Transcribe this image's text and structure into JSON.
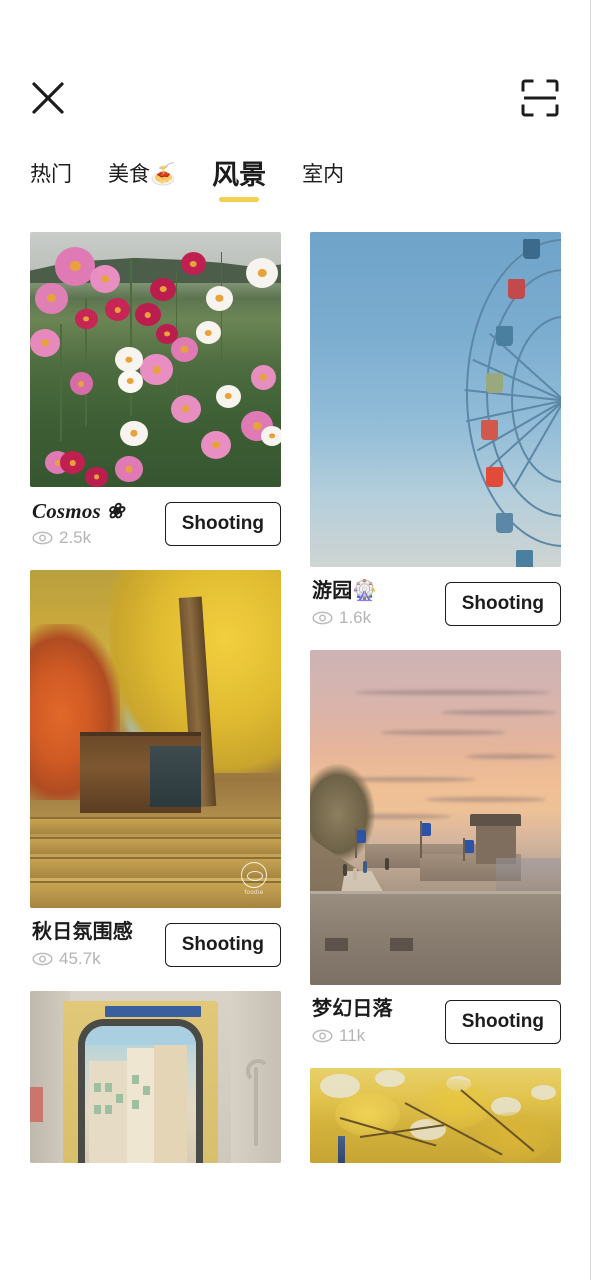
{
  "header": {
    "close_icon": "close-icon",
    "scan_icon": "scan-frame-icon"
  },
  "tabs": [
    {
      "label": "热门",
      "active": false
    },
    {
      "label": "美食🍝",
      "active": false
    },
    {
      "label": "风景",
      "active": true
    },
    {
      "label": "室内",
      "active": false
    }
  ],
  "accent_color": "#f5cf52",
  "shoot_label": "Shooting",
  "cards": {
    "left": [
      {
        "title": "Cosmos ❀",
        "title_style": "serif-italic",
        "views": "2.5k",
        "action": "Shooting",
        "photo": "cosmos-flower-field"
      },
      {
        "title": "秋日氛围感",
        "title_style": "sans",
        "views": "45.7k",
        "action": "Shooting",
        "photo": "autumn-cafe-ginkgo",
        "watermark": "foodie"
      },
      {
        "title": "",
        "title_style": "sans",
        "views": "",
        "action": "",
        "photo": "train-door-window"
      }
    ],
    "right": [
      {
        "title": "游园🎡",
        "title_style": "sans",
        "views": "1.6k",
        "action": "Shooting",
        "photo": "ferris-wheel-blue-sky"
      },
      {
        "title": "梦幻日落",
        "title_style": "sans",
        "views": "11k",
        "action": "Shooting",
        "photo": "fortress-wall-sunset"
      },
      {
        "title": "",
        "title_style": "sans",
        "views": "",
        "action": "",
        "photo": "golden-ginkgo-canopy"
      }
    ]
  }
}
